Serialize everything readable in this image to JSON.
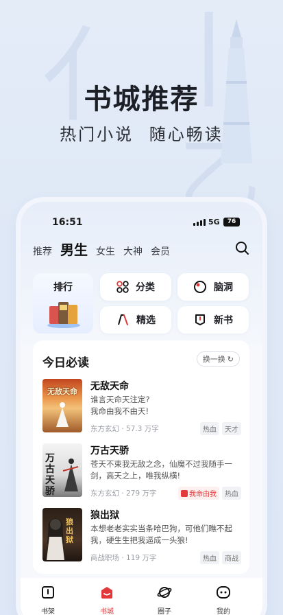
{
  "hero": {
    "title": "书城推荐",
    "subtitle": "热门小说  随心畅读"
  },
  "status_bar": {
    "time": "16:51",
    "network": "5G",
    "battery": "76"
  },
  "tabs": [
    "推荐",
    "男生",
    "女生",
    "大神",
    "会员"
  ],
  "active_tab": "男生",
  "quick_entries": {
    "rank": "排行",
    "category": "分类",
    "brain": "脑洞",
    "featured": "精选",
    "new_books": "新书"
  },
  "daily": {
    "title": "今日必读",
    "swap_label": "换一换",
    "books": [
      {
        "title": "无敌天命",
        "desc": "谁言天命天注定?\n我命由我不由天!",
        "meta": "东方玄幻 · 57.3 万字",
        "tags": [
          "热血",
          "天才"
        ],
        "cover_text": "无敌天命"
      },
      {
        "title": "万古天骄",
        "desc": "苍天不束我无敌之念，仙魔不过我随手一剑，高天之上，唯我纵横!",
        "meta": "东方玄幻 · 279 万字",
        "tags": [
          "我命由我",
          "热血"
        ],
        "cover_text": "万古天骄"
      },
      {
        "title": "狼出狱",
        "desc": "本想老老实实当条哈巴狗，可他们瞧不起我，硬生生把我逼成一头狼!",
        "meta": "商战职场 · 119 万字",
        "tags": [
          "热血",
          "商战"
        ],
        "cover_text": "狼出狱"
      }
    ]
  },
  "bottom_nav": [
    "书架",
    "书城",
    "圈子",
    "我的"
  ],
  "bottom_nav_active": "书城",
  "colors": {
    "accent": "#e23a3a",
    "background": "#e4ecf8"
  }
}
